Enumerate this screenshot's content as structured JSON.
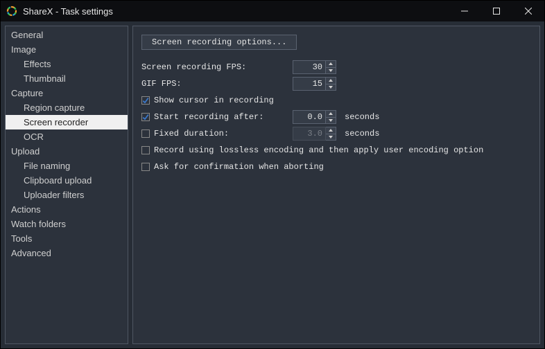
{
  "window": {
    "title": "ShareX - Task settings"
  },
  "sidebar": {
    "items": [
      {
        "label": "General",
        "level": 0
      },
      {
        "label": "Image",
        "level": 0
      },
      {
        "label": "Effects",
        "level": 1
      },
      {
        "label": "Thumbnail",
        "level": 1
      },
      {
        "label": "Capture",
        "level": 0
      },
      {
        "label": "Region capture",
        "level": 1
      },
      {
        "label": "Screen recorder",
        "level": 1,
        "selected": true
      },
      {
        "label": "OCR",
        "level": 1
      },
      {
        "label": "Upload",
        "level": 0
      },
      {
        "label": "File naming",
        "level": 1
      },
      {
        "label": "Clipboard upload",
        "level": 1
      },
      {
        "label": "Uploader filters",
        "level": 1
      },
      {
        "label": "Actions",
        "level": 0
      },
      {
        "label": "Watch folders",
        "level": 0
      },
      {
        "label": "Tools",
        "level": 0
      },
      {
        "label": "Advanced",
        "level": 0
      }
    ]
  },
  "main": {
    "options_button": "Screen recording options...",
    "fps_label": "Screen recording FPS:",
    "fps_value": "30",
    "gif_fps_label": "GIF FPS:",
    "gif_fps_value": "15",
    "show_cursor_label": "Show cursor in recording",
    "show_cursor_checked": true,
    "start_after_label": "Start recording after:",
    "start_after_checked": true,
    "start_after_value": "0.0",
    "seconds_suffix": "seconds",
    "fixed_duration_label": "Fixed duration:",
    "fixed_duration_checked": false,
    "fixed_duration_value": "3.0",
    "lossless_label": "Record using lossless encoding and then apply user encoding option",
    "lossless_checked": false,
    "ask_confirm_label": "Ask for confirmation when aborting",
    "ask_confirm_checked": false
  }
}
